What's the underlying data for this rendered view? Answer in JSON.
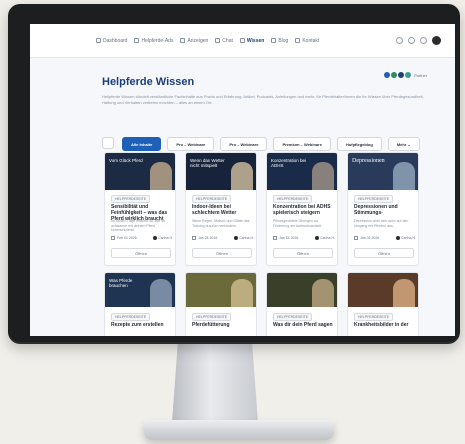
{
  "nav": {
    "items": [
      {
        "label": "Dashboard",
        "icon": "home-icon"
      },
      {
        "label": "Helpferde-Ads",
        "icon": "horse-icon"
      },
      {
        "label": "Anzeigen",
        "icon": "dollar-icon"
      },
      {
        "label": "Chat",
        "icon": "chat-icon"
      },
      {
        "label": "Wissen",
        "icon": "book-icon"
      },
      {
        "label": "Blog",
        "icon": "blog-icon"
      },
      {
        "label": "Kontakt",
        "icon": "mail-icon"
      }
    ],
    "active_index": 4
  },
  "header": {
    "title": "Helpferde Wissen",
    "subtitle": "Hellpferde Wissen bündelt verständliche Fachinhalte aus Praxis und Erfahrung. Artikel, Podcasts, Anleitungen und mehr, für Pferdehalter/innen die ihr Wissen über Pferdegesundheit, Haltung und Verhalten vertiefen möchten – alles an einem Ort."
  },
  "badges": {
    "label": "Partner",
    "colors": [
      "#1e5fb8",
      "#2e8b57",
      "#1c3f7a",
      "#3b9c8f"
    ]
  },
  "filters": [
    {
      "label": "Alle Inhalte",
      "active": true
    },
    {
      "label": "Pro – Webinare",
      "active": false
    },
    {
      "label": "Pro – Webinare",
      "active": false
    },
    {
      "label": "Premium – Webinare",
      "active": false
    },
    {
      "label": "Hufpflegeblog",
      "active": false
    },
    {
      "label": "Mehr ⌄",
      "active": false
    }
  ],
  "cards_row1": [
    {
      "img_text": "Vom Glück Pferd",
      "img_bg": "#1d2a44",
      "img_accent": "#b9a58a",
      "serif": false,
      "tag": "HELPFERDESEITE",
      "title": "Sensibilität und Feinfühlgkeit – was das Pferd wirklich braucht",
      "desc": "Im neuen Folge erfährst du, wie du achtsamer mit deinem Pferd kommunizierst.",
      "date": "Feb 01 2026",
      "author": "Carina H.",
      "button": "Öffnen"
    },
    {
      "img_text": "Wenn das Wetter nicht mitspielt",
      "img_bg": "#17233a",
      "img_accent": "#c8b79a",
      "serif": false,
      "tag": "HELPFERDESEITE",
      "title": "Indoor-Ideen bei schlechtem Wetter",
      "desc": "Wenn Regen, Matsch und Glätte das Training draußen verhindern.",
      "date": "Jan 28 2026",
      "author": "Carina H.",
      "button": "Öffnen"
    },
    {
      "img_text": "Konzentration bei ADHS",
      "img_bg": "#1a2b4a",
      "img_accent": "#9b8f85",
      "serif": false,
      "tag": "HELPFERDESEITE",
      "title": "Konzentration bei ADHS spielerisch steigern",
      "desc": "Pferdegestützte Übungen zur Förderung der Aufmerksamkeit.",
      "date": "Jan 15 2026",
      "author": "Carina H.",
      "button": "Öffnen"
    },
    {
      "img_text": "Depressionen",
      "img_bg": "#2a3a5a",
      "img_accent": "#8ea3b8",
      "serif": true,
      "tag": "HELPFERDESEITE",
      "title": "Depressionen und Stimmungs-",
      "desc": "Depression wirkt sich auch auf den Umgang mit Pferden aus.",
      "date": "Jan 03 2026",
      "author": "Carina H.",
      "button": "Öffnen"
    }
  ],
  "cards_row2": [
    {
      "img_text": "Was Pferde brauchen",
      "img_bg": "#1f3352",
      "img_accent": "#8a9bb0",
      "serif": false,
      "tag": "HELPFERDESEITE",
      "title": "Rezepte zum erstellen"
    },
    {
      "img_text": "",
      "img_bg": "#6b6a3a",
      "img_accent": "#c9b98a",
      "serif": false,
      "tag": "HELPFERDESEITE",
      "title": "Pferdefütterung"
    },
    {
      "img_text": "",
      "img_bg": "#3a3f2a",
      "img_accent": "#b7a27c",
      "serif": false,
      "tag": "HELPFERDESEITE",
      "title": "Was dir dein Pferd sagen"
    },
    {
      "img_text": "",
      "img_bg": "#5a3b2a",
      "img_accent": "#d2a87e",
      "serif": false,
      "tag": "HELPFERDESEITE",
      "title": "Krankheitsbilder in der"
    }
  ]
}
